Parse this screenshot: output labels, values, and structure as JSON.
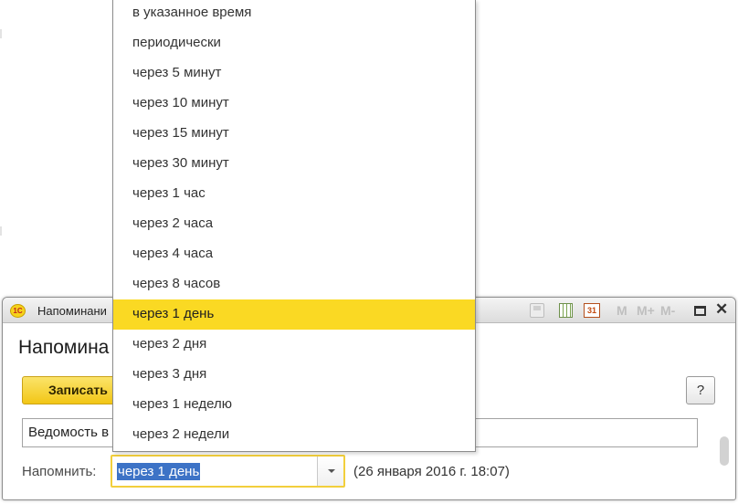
{
  "window": {
    "title": "Напоминани",
    "toolbar_icons": [
      "save-icon",
      "calculator-icon",
      "calendar-icon",
      "m-icon",
      "m-plus-icon",
      "m-minus-icon",
      "maximize-icon",
      "close-icon"
    ],
    "calendar_day": "31",
    "memory": {
      "m": "M",
      "m_plus": "M+",
      "m_minus": "M-"
    },
    "close_glyph": "✕"
  },
  "form": {
    "title": "Напомина",
    "write_button": "Записать",
    "help_button": "?",
    "subject_value": "Ведомость в",
    "remind_label": "Напомнить:",
    "remind_value": "через 1 день",
    "remind_time": "(26 января 2016 г. 18:07)"
  },
  "dropdown": {
    "selected_index": 10,
    "options": [
      "в указанное время",
      "периодически",
      "через 5 минут",
      "через 10 минут",
      "через 15 минут",
      "через 30 минут",
      "через 1 час",
      "через 2 часа",
      "через 4 часа",
      "через 8 часов",
      "через 1 день",
      "через 2 дня",
      "через 3 дня",
      "через 1 неделю",
      "через 2 недели"
    ]
  },
  "colors": {
    "accent_yellow": "#fad923",
    "selection_blue": "#3d73c6",
    "focus_border": "#f2cf3c"
  },
  "app_logo": "1С"
}
